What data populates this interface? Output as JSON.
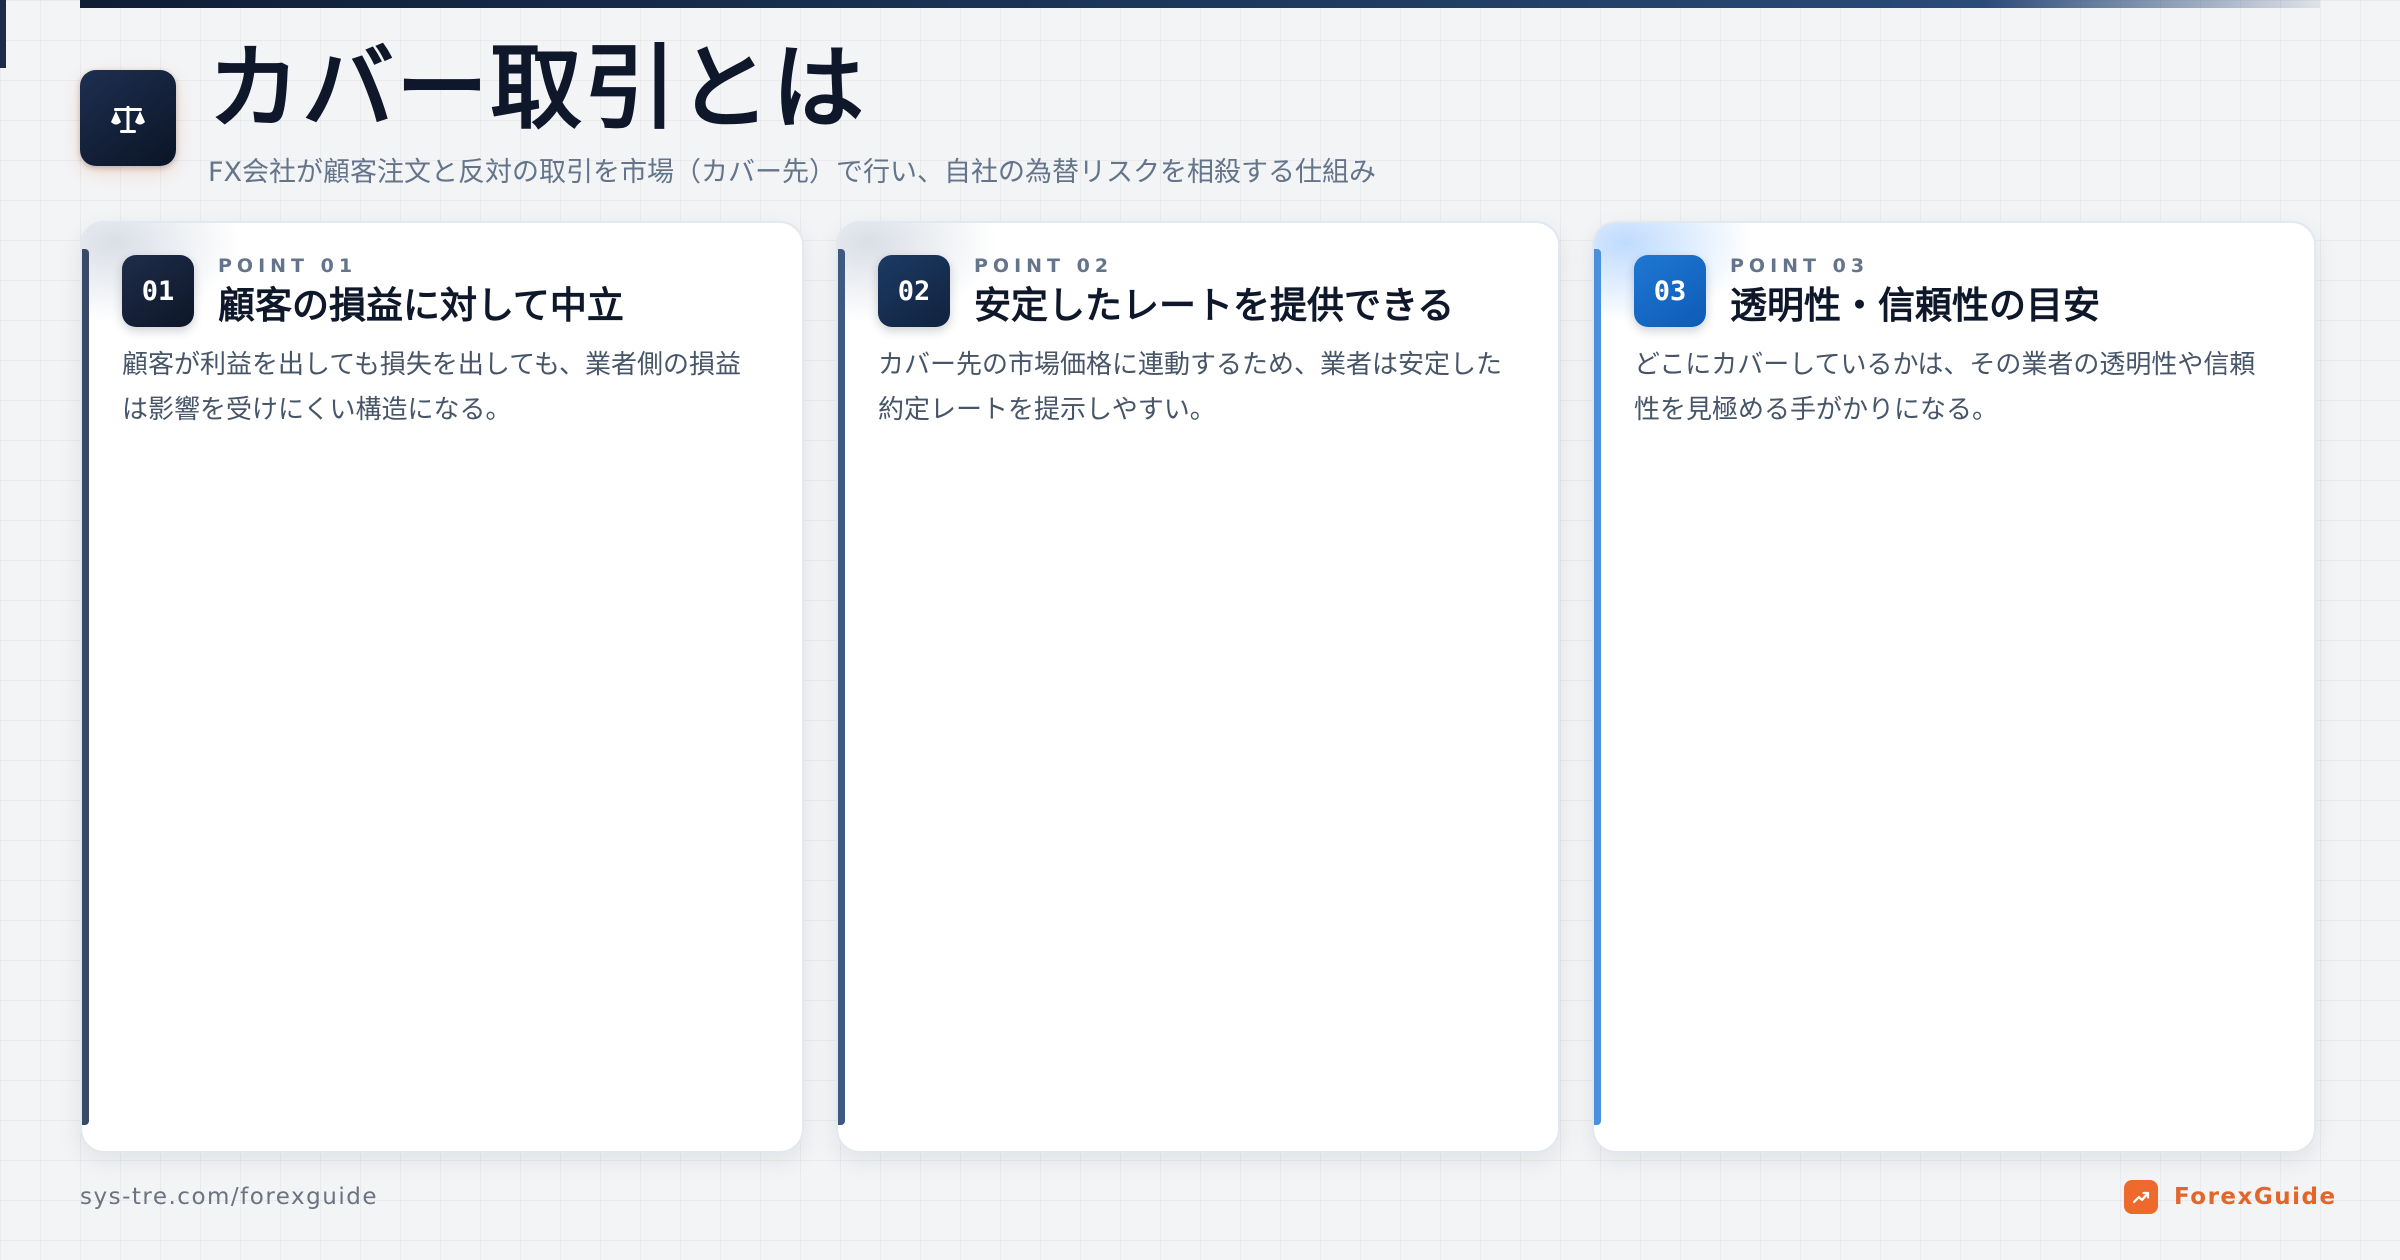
{
  "header": {
    "title": "カバー取引とは",
    "subtitle": "FX会社が顧客注文と反対の取引を市場（カバー先）で行い、自社の為替リスクを相殺する仕組み",
    "icon": "scale-icon"
  },
  "cards": [
    {
      "number": "01",
      "point_label": "POINT 01",
      "title": "顧客の損益に対して中立",
      "body": "顧客が利益を出しても損失を出しても、業者側の損益は影響を受けにくい構造になる。",
      "accent": "#1e2a44"
    },
    {
      "number": "02",
      "point_label": "POINT 02",
      "title": "安定したレートを提供できる",
      "body": "カバー先の市場価格に連動するため、業者は安定した約定レートを提示しやすい。",
      "accent": "#1e3a5f"
    },
    {
      "number": "03",
      "point_label": "POINT 03",
      "title": "透明性・信頼性の目安",
      "body": "どこにカバーしているかは、その業者の透明性や信頼性を見極める手がかりになる。",
      "accent": "#2f80d8"
    }
  ],
  "footer": {
    "url": "sys-tre.com/forexguide",
    "brand": "ForexGuide",
    "brand_icon": "trending-up-icon",
    "brand_color": "#ee6a2c"
  }
}
